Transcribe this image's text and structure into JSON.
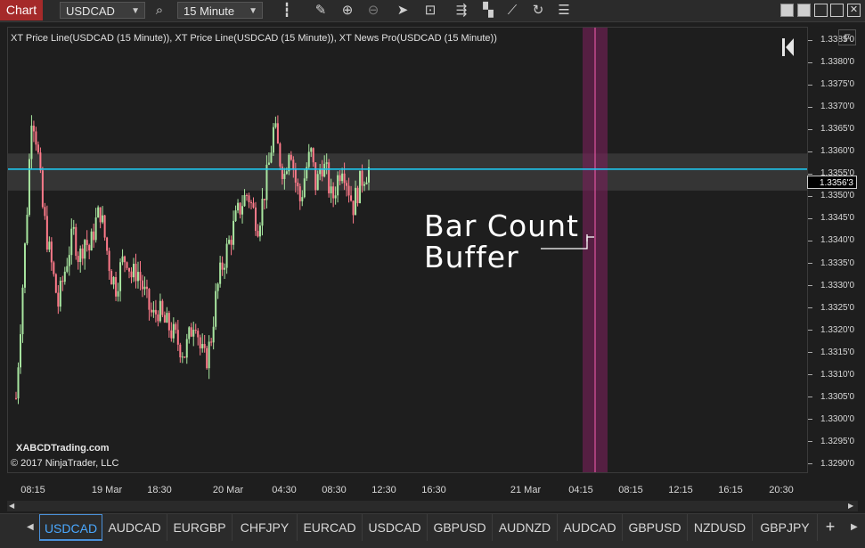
{
  "toolbar": {
    "chart_tab": "Chart",
    "instrument": "USDCAD",
    "interval": "15 Minute",
    "icons": [
      "search-icon",
      "bars-icon",
      "pencil-icon",
      "zoom-in-icon",
      "zoom-out-icon",
      "pointer-icon",
      "data-box-icon",
      "strategy-icon",
      "chart-style-icon",
      "drawing-tools-icon",
      "refresh-icon",
      "properties-icon"
    ]
  },
  "chart": {
    "indicators_label": "XT Price Line(USDCAD (15 Minute)), XT Price Line(USDCAD (15 Minute)), XT News Pro(USDCAD (15 Minute))",
    "watermark_site": "XABCDTrading.com",
    "watermark_copyright": "© 2017 NinjaTrader, LLC",
    "annotation_line1": "Bar Count",
    "annotation_line2": "Buffer",
    "f_button": "F",
    "current_price_label": "1.3356'3",
    "colors": {
      "background": "#1e1e1e",
      "up_candle": "#a8e6a0",
      "down_candle": "#ff7a8a",
      "price_line": "#1ec8f0",
      "zone": "#3a3a3a",
      "buffer": "#7a1f5a"
    }
  },
  "chart_data": {
    "type": "candlestick",
    "instrument": "USDCAD",
    "current_price": 1.33563,
    "ylim": [
      1.3288,
      1.3388
    ],
    "y_ticks": [
      "1.3385'0",
      "1.3380'0",
      "1.3375'0",
      "1.3370'0",
      "1.3365'0",
      "1.3360'0",
      "1.3355'0",
      "1.3350'0",
      "1.3345'0",
      "1.3340'0",
      "1.3335'0",
      "1.3330'0",
      "1.3325'0",
      "1.3320'0",
      "1.3315'0",
      "1.3310'0",
      "1.3305'0",
      "1.3300'0",
      "1.3295'0",
      "1.3290'0"
    ],
    "x_ticks": [
      "08:15",
      "19 Mar",
      "18:30",
      "20 Mar",
      "04:30",
      "08:30",
      "12:30",
      "16:30",
      "21 Mar",
      "04:15",
      "08:15",
      "12:15",
      "16:15",
      "20:30"
    ],
    "zone_range": [
      1.33515,
      1.33598
    ],
    "price_path": [
      1.3305,
      1.3325,
      1.3345,
      1.337,
      1.3362,
      1.3348,
      1.334,
      1.3333,
      1.3326,
      1.3332,
      1.3338,
      1.3342,
      1.3336,
      1.3341,
      1.3338,
      1.3344,
      1.3347,
      1.334,
      1.3333,
      1.333,
      1.3335,
      1.3337,
      1.3332,
      1.3334,
      1.333,
      1.3326,
      1.3323,
      1.3325,
      1.3322,
      1.3321,
      1.3319,
      1.3317,
      1.3315,
      1.3319,
      1.3324,
      1.3316,
      1.3313,
      1.3318,
      1.3328,
      1.3334,
      1.3338,
      1.3342,
      1.3346,
      1.3349,
      1.3351,
      1.3347,
      1.3344,
      1.335,
      1.3357,
      1.3366,
      1.3359,
      1.3355,
      1.3363,
      1.3354,
      1.3349,
      1.3356,
      1.336,
      1.3352,
      1.3358,
      1.3355,
      1.3349,
      1.3354,
      1.3358,
      1.3353,
      1.3348,
      1.3352,
      1.3355,
      1.33563
    ]
  },
  "instrument_tabs": [
    "USDCAD",
    "AUDCAD",
    "EURGBP",
    "CHFJPY",
    "EURCAD",
    "USDCAD",
    "GBPUSD",
    "AUDNZD",
    "AUDCAD",
    "GBPUSD",
    "NZDUSD",
    "GBPJPY"
  ],
  "tabs_add": "+"
}
